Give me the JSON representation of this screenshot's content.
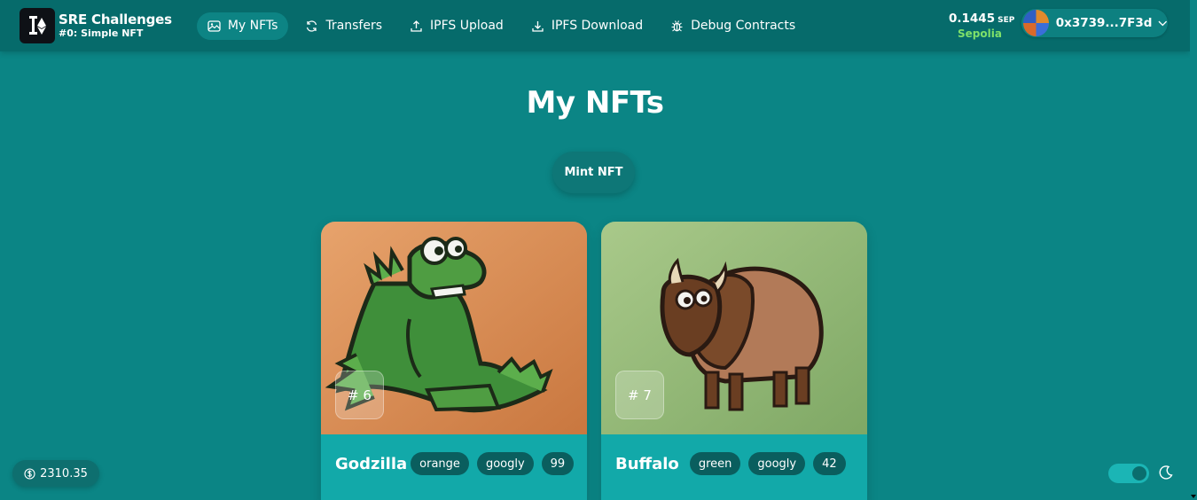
{
  "brand": {
    "title": "SRE Challenges",
    "subtitle": "#0: Simple NFT"
  },
  "nav": [
    {
      "label": "My NFTs",
      "icon": "image-icon",
      "active": true
    },
    {
      "label": "Transfers",
      "icon": "refresh-icon",
      "active": false
    },
    {
      "label": "IPFS Upload",
      "icon": "upload-icon",
      "active": false
    },
    {
      "label": "IPFS Download",
      "icon": "download-icon",
      "active": false
    },
    {
      "label": "Debug Contracts",
      "icon": "bug-icon",
      "active": false
    }
  ],
  "wallet": {
    "balance": "0.1445",
    "unit": "SEP",
    "network": "Sepolia",
    "address": "0x3739...7F3d"
  },
  "main": {
    "title": "My NFTs",
    "mint_label": "Mint NFT"
  },
  "nfts": [
    {
      "id": "# 6",
      "name": "Godzilla",
      "tags": [
        "orange",
        "googly",
        "99"
      ],
      "description": ""
    },
    {
      "id": "# 7",
      "name": "Buffalo",
      "tags": [
        "green",
        "googly",
        "42"
      ],
      "description": ""
    }
  ],
  "footer": {
    "price": "2310.35"
  },
  "colors": {
    "header": "#066b6b",
    "background": "#0b8585",
    "card": "#12a9a9",
    "network": "#7ee06a"
  }
}
